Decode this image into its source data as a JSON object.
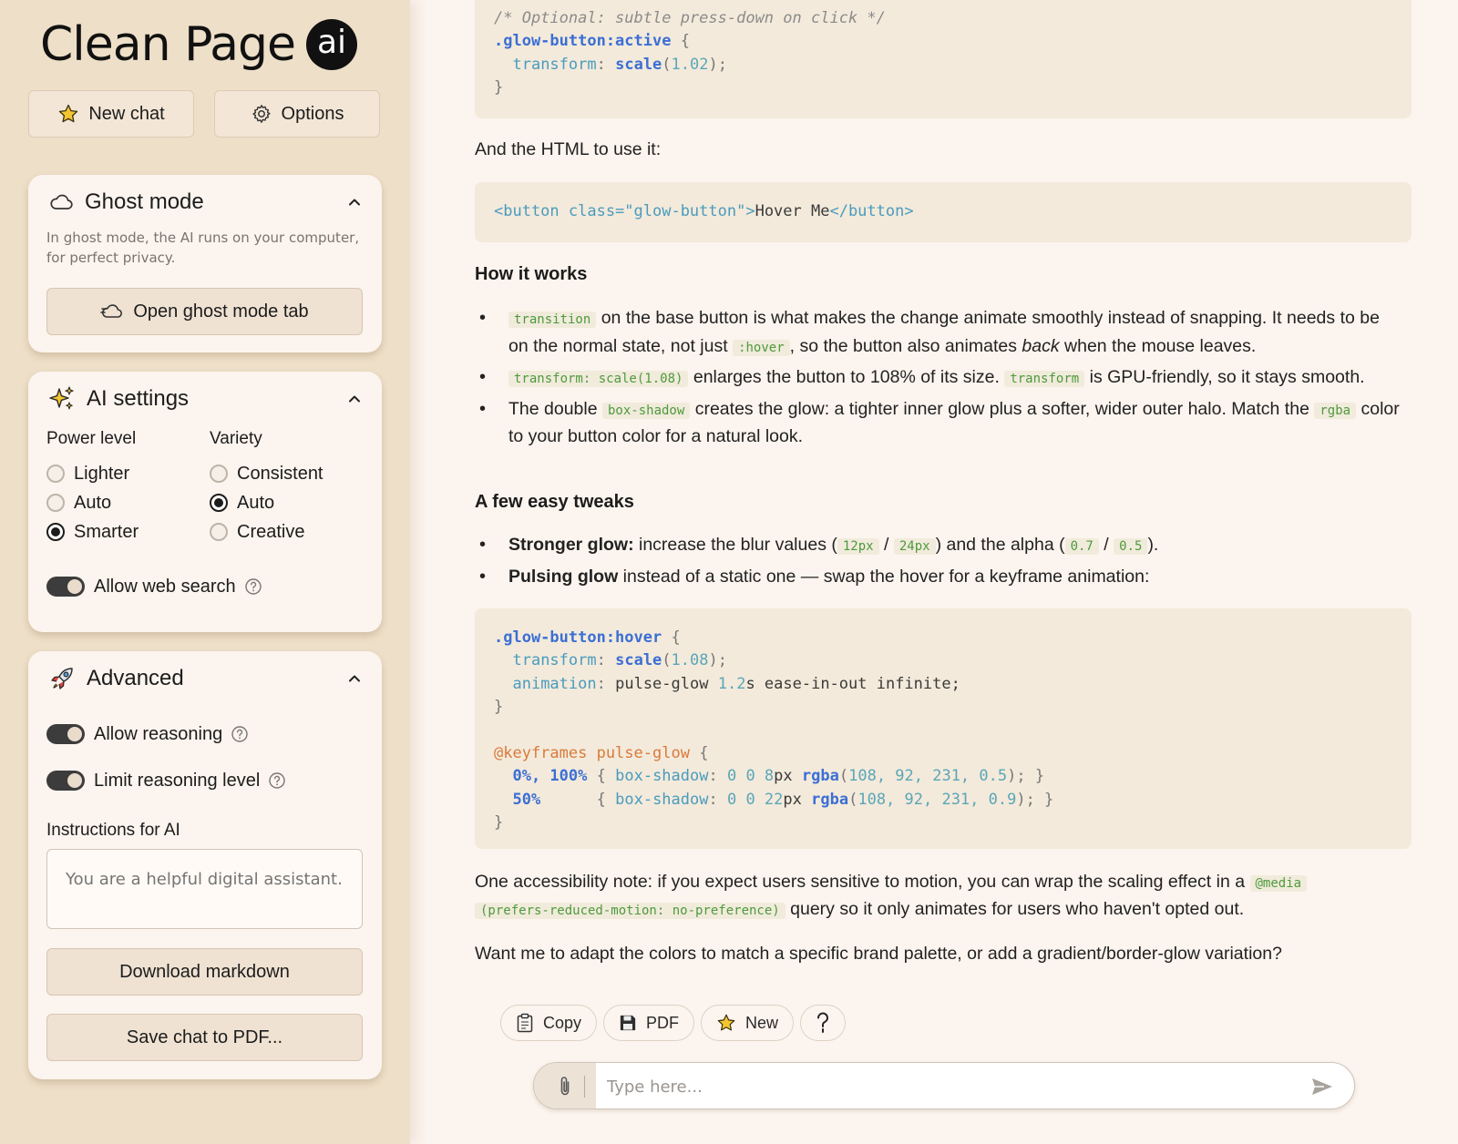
{
  "app": {
    "logo_text": "Clean Page",
    "logo_badge": "ai"
  },
  "sidebar": {
    "new_chat_label": "New chat",
    "options_label": "Options",
    "ghost": {
      "title": "Ghost mode",
      "description": "In ghost mode, the AI runs on your computer, for perfect privacy.",
      "open_button": "Open ghost mode tab"
    },
    "ai_settings": {
      "title": "AI settings",
      "power_label": "Power level",
      "power_options": [
        {
          "label": "Lighter",
          "selected": false
        },
        {
          "label": "Auto",
          "selected": false
        },
        {
          "label": "Smarter",
          "selected": true
        }
      ],
      "variety_label": "Variety",
      "variety_options": [
        {
          "label": "Consistent",
          "selected": false
        },
        {
          "label": "Auto",
          "selected": true
        },
        {
          "label": "Creative",
          "selected": false
        }
      ],
      "web_search_label": "Allow web search",
      "web_search_on": true
    },
    "advanced": {
      "title": "Advanced",
      "reasoning_label": "Allow reasoning",
      "reasoning_on": true,
      "limit_label": "Limit reasoning level",
      "limit_on": true,
      "instructions_label": "Instructions for AI",
      "instructions_placeholder": "You are a helpful digital assistant.",
      "download_label": "Download markdown",
      "save_pdf_label": "Save chat to PDF..."
    }
  },
  "message": {
    "code1": {
      "comment": "/* Optional: subtle press-down on click */",
      "selector": ".glow-button:active",
      "prop": "transform",
      "fn": "scale",
      "num": "1.02"
    },
    "html_intro": "And the HTML to use it:",
    "code2": {
      "open_tag": "<button class=\"glow-button\">",
      "text": "Hover Me",
      "close_tag": "</button>"
    },
    "how_heading": "How it works",
    "how_items": {
      "b1_code1": "transition",
      "b1_text1": " on the base button is what makes the change animate smoothly instead of snapping. It needs to be on the normal state, not just ",
      "b1_code2": ":hover",
      "b1_text2": ", so the button also animates ",
      "b1_em": "back",
      "b1_text3": " when the mouse leaves.",
      "b2_code1": "transform: scale(1.08)",
      "b2_text1": " enlarges the button to 108% of its size. ",
      "b2_code2": "transform",
      "b2_text2": " is GPU-friendly, so it stays smooth.",
      "b3_text1": "The double ",
      "b3_code1": "box-shadow",
      "b3_text2": " creates the glow: a tighter inner glow plus a softer, wider outer halo. Match the ",
      "b3_code2": "rgba",
      "b3_text3": " color to your button color for a natural look."
    },
    "tweaks_heading": "A few easy tweaks",
    "tweaks": {
      "t1_bold": "Stronger glow:",
      "t1_text1": " increase the blur values (",
      "t1_code1": "12px",
      "t1_sep1": " / ",
      "t1_code2": "24px",
      "t1_text2": ") and the alpha (",
      "t1_code3": "0.7",
      "t1_sep2": " / ",
      "t1_code4": "0.5",
      "t1_text3": ").",
      "t2_bold": "Pulsing glow",
      "t2_text": " instead of a static one — swap the hover for a keyframe animation:"
    },
    "code3": {
      "selector": ".glow-button:hover",
      "prop1": "transform",
      "fn1": "scale",
      "num1": "1.08",
      "prop2": "animation",
      "anim_name": "pulse-glow",
      "anim_dur": "1.2",
      "anim_rest": "s ease-in-out infinite;",
      "at_rule": "@keyframes pulse-glow",
      "kf1_key": "0%, 100%",
      "kf1_prop": "box-shadow",
      "kf1_val": "0 0 8",
      "kf1_unit": "px",
      "kf1_fn": "rgba",
      "kf1_args": "108, 92, 231, 0.5",
      "kf2_key": "50%",
      "kf2_prop": "box-shadow",
      "kf2_val": "0 0 22",
      "kf2_unit": "px",
      "kf2_fn": "rgba",
      "kf2_args": "108, 92, 231, 0.9"
    },
    "a11y": {
      "text1": "One accessibility note: if you expect users sensitive to motion, you can wrap the scaling effect in a ",
      "code1": "@media",
      "code2": "(prefers-reduced-motion: no-preference)",
      "text2": " query so it only animates for users who haven't opted out."
    },
    "closing": "Want me to adapt the colors to match a specific brand palette, or add a gradient/border-glow variation?"
  },
  "actions": {
    "copy_label": "Copy",
    "pdf_label": "PDF",
    "new_label": "New"
  },
  "composer": {
    "placeholder": "Type here..."
  },
  "colors": {
    "sidebar_bg": "#eedfc8",
    "main_bg": "#fcf4ee",
    "code_bg": "#f3eadb",
    "inline_code": "#4e9a3c",
    "code_keyword": "#3b6fd4",
    "code_prop": "#4a9bbd",
    "code_at_rule": "#d97a3a"
  }
}
